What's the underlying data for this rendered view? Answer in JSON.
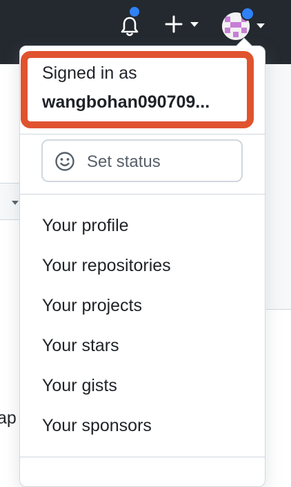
{
  "header": {
    "notifications_icon": "bell-icon",
    "create_icon": "plus-icon",
    "avatar_icon": "identicon-avatar",
    "notification_color": "#2f81f7"
  },
  "account_menu": {
    "signed_in_label": "Signed in as",
    "username": "wangbohan090709...",
    "highlight_color": "#e0532f",
    "set_status": {
      "icon": "smiley-icon",
      "label": "Set status"
    },
    "items": [
      {
        "label": "Your profile"
      },
      {
        "label": "Your repositories"
      },
      {
        "label": "Your projects"
      },
      {
        "label": "Your stars"
      },
      {
        "label": "Your gists"
      },
      {
        "label": "Your sponsors"
      }
    ]
  },
  "background": {
    "partial_text": "ap"
  }
}
